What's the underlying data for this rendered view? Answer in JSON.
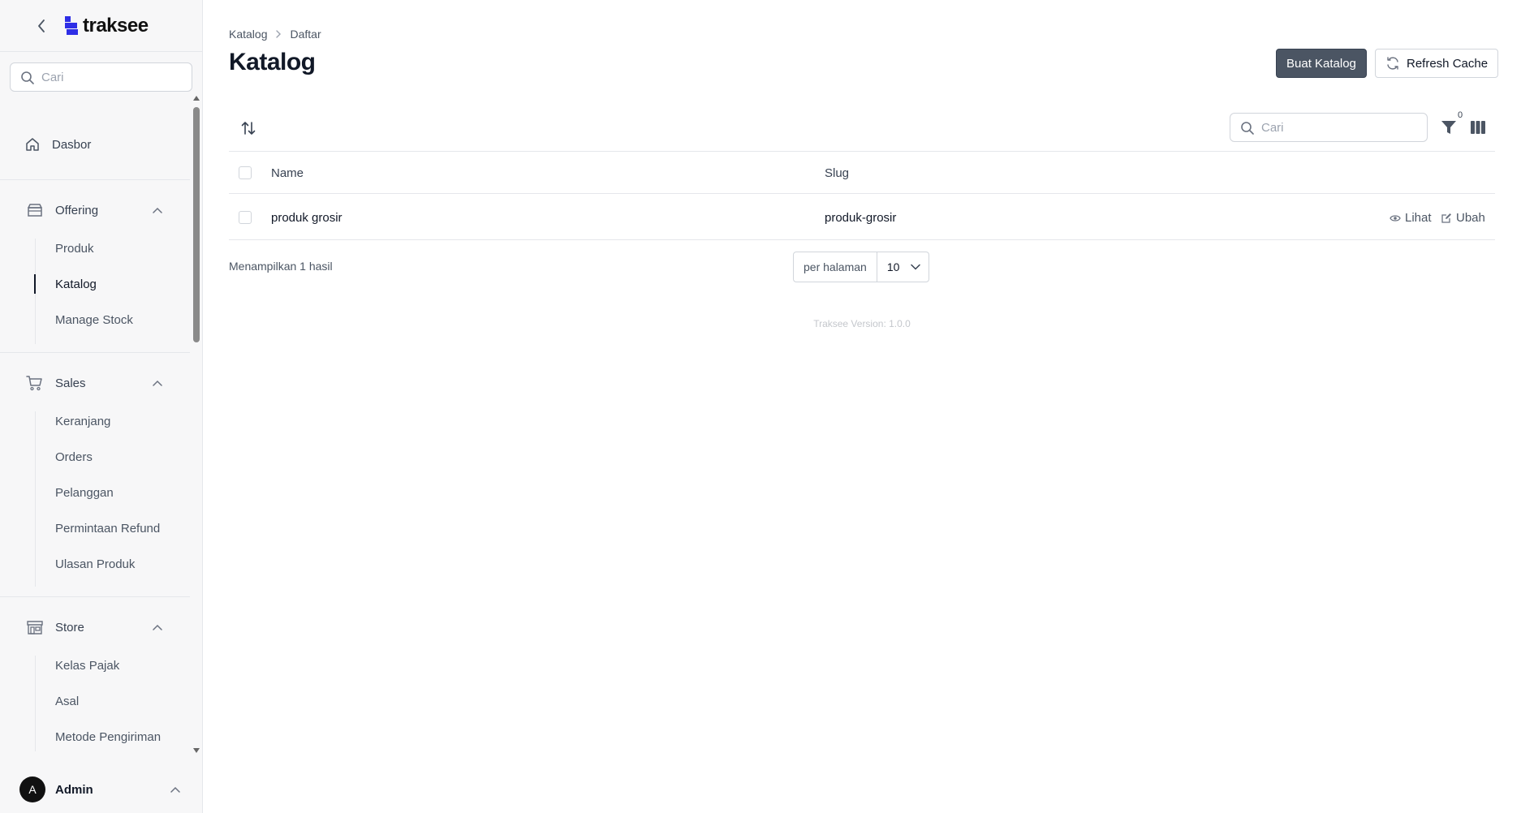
{
  "brand": {
    "name": "traksee",
    "color": "#2e2ee6"
  },
  "sidebar": {
    "search_placeholder": "Cari",
    "dashboard": "Dasbor",
    "groups": [
      {
        "label": "Offering",
        "items": [
          "Produk",
          "Katalog",
          "Manage Stock"
        ]
      },
      {
        "label": "Sales",
        "items": [
          "Keranjang",
          "Orders",
          "Pelanggan",
          "Permintaan Refund",
          "Ulasan Produk"
        ]
      },
      {
        "label": "Store",
        "items": [
          "Kelas Pajak",
          "Asal",
          "Metode Pengiriman"
        ]
      }
    ],
    "active_item": "Katalog",
    "user": {
      "initial": "A",
      "name": "Admin"
    }
  },
  "breadcrumb": [
    "Katalog",
    "Daftar"
  ],
  "page_title": "Katalog",
  "actions": {
    "create": "Buat Katalog",
    "refresh": "Refresh Cache"
  },
  "table": {
    "search_placeholder": "Cari",
    "filter_count": "0",
    "columns": [
      "Name",
      "Slug"
    ],
    "rows": [
      {
        "name": "produk grosir",
        "slug": "produk-grosir",
        "view": "Lihat",
        "edit": "Ubah"
      }
    ]
  },
  "footer": {
    "results": "Menampilkan 1 hasil",
    "per_page_label": "per halaman",
    "per_page_value": "10",
    "version": "Traksee Version: 1.0.0"
  }
}
